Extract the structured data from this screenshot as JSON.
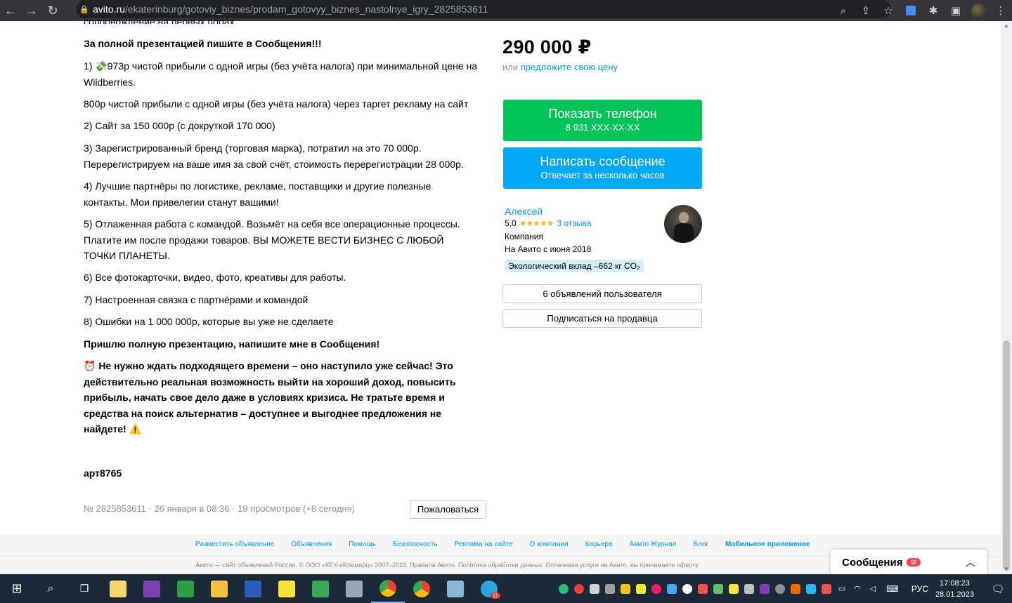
{
  "browser": {
    "url_host": "avito.ru",
    "url_path": "/ekaterinburg/gotoviy_biznes/prodam_gotovyy_biznes_nastolnye_igry_2825853611"
  },
  "description": {
    "cut_line": "сопровождение на первых порах.",
    "paragraphs": [
      "За полной презентацией пишите в Сообщения!!!",
      "1) 💸973р чистой прибыли с одной игры (без учёта налога) при минимальной цене на Wildberries.",
      "800р чистой прибыли с одной игры (без учёта налога) через таргет рекламу на сайт",
      "2) Сайт за 150 000р (с докруткой 170 000)",
      "3) Зарегистрированный бренд (торговая марка), потратил на это 70 000р. Перерегистрируем на ваше имя за свой счёт, стоимость перерегистрации 28 000р.",
      "4) Лучшие партнёры по логистике, рекламе, поставщики и другие полезные контакты. Мои привелегии станут вашими!",
      "5) Отлаженная работа с командой. Возьмёт на себя все операционные процессы. Платите им после продажи товаров. ВЫ МОЖЕТЕ ВЕСТИ БИЗНЕС С ЛЮБОЙ ТОЧКИ ПЛАНЕТЫ.",
      "6) Все фотокарточки, видео, фото, креативы для работы.",
      "7) Настроенная связка с партнёрами и командой",
      "8) Ошибки на 1 000 000р, которые вы уже не сделаете",
      "Пришлю полную презентацию, напишите мне в Сообщения!",
      "⏰ Не нужно ждать подходящего времени – оно наступило уже сейчас! Это действительно реальная возможность выйти на хороший доход, повысить прибыль, начать свое дело даже в условиях кризиса. Не тратьте время и средства на поиск альтернатив – доступнее и выгоднее предложения не найдете! ⚠️",
      "арт8765"
    ]
  },
  "listing_meta": "№ 2825853611 · 26 января в 08:36 · 19 просмотров (+8 сегодня)",
  "report_label": "Пожаловаться",
  "price": "290 000 ₽",
  "offer": {
    "prefix": "или",
    "link": "предложите свою цену"
  },
  "phone_button": {
    "label": "Показать телефон",
    "sub": "8 931 XXX-XX-XX"
  },
  "message_button": {
    "label": "Написать сообщение",
    "sub": "Отвечает за несколько часов"
  },
  "seller": {
    "name": "Алексей",
    "rating": "5,0",
    "stars": "★★★★★",
    "reviews": "3 отзыва",
    "type": "Компания",
    "since": "На Авито с июня 2018",
    "eco": "Экологический вклад –662 кг CO₂"
  },
  "user_ads_button": "6 объявлений пользователя",
  "subscribe_button": "Подписаться на продавца",
  "footer": {
    "links": [
      "Разместить объявление",
      "Объявления",
      "Помощь",
      "Безопасность",
      "Реклама на сайте",
      "О компании",
      "Карьера",
      "Авито Журнал",
      "Блог",
      "Мобильное приложение"
    ],
    "legal": "Авито — сайт объявлений России. © ООО «КЕХ еКоммерц» 2007–2023. Правила Авито. Политика обработки данных. Оплачивая услуги на Авито, вы принимаете оферту."
  },
  "messages_widget": {
    "label": "Сообщения",
    "count": "96"
  },
  "taskbar": {
    "lang": "РУС",
    "time": "17:08:23",
    "date": "28.01.2023",
    "telegram_badge": "11"
  },
  "colors": {
    "green": "#04c459",
    "blue": "#00a8f6",
    "link": "#0099f7"
  }
}
